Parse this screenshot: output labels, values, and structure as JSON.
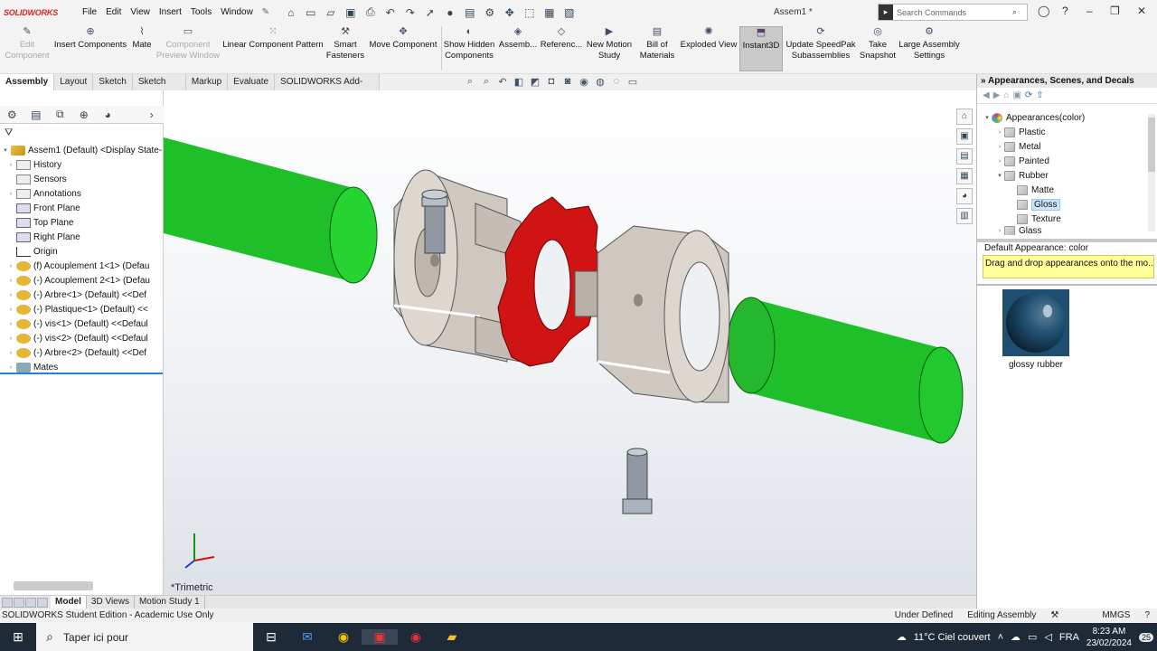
{
  "app": {
    "logo": "SOLIDWORKS",
    "document_title": "Assem1 *"
  },
  "menu": [
    "File",
    "Edit",
    "View",
    "Insert",
    "Tools",
    "Window"
  ],
  "search": {
    "placeholder": "Search Commands"
  },
  "commands": [
    {
      "label": "Edit Component",
      "state": "disabled"
    },
    {
      "label": "Insert Components",
      "state": "normal"
    },
    {
      "label": "Mate",
      "state": "normal"
    },
    {
      "label": "Component Preview Window",
      "state": "disabled"
    },
    {
      "label": "Linear Component Pattern",
      "state": "normal"
    },
    {
      "label": "Smart Fasteners",
      "state": "normal"
    },
    {
      "label": "Move Component",
      "state": "normal"
    },
    {
      "label": "Show Hidden Components",
      "state": "normal"
    },
    {
      "label": "Assemb...",
      "state": "normal"
    },
    {
      "label": "Referenc...",
      "state": "normal"
    },
    {
      "label": "New Motion Study",
      "state": "normal"
    },
    {
      "label": "Bill of Materials",
      "state": "normal"
    },
    {
      "label": "Exploded View",
      "state": "normal"
    },
    {
      "label": "Instant3D",
      "state": "active"
    },
    {
      "label": "Update SpeedPak Subassemblies",
      "state": "normal"
    },
    {
      "label": "Take Snapshot",
      "state": "normal"
    },
    {
      "label": "Large Assembly Settings",
      "state": "normal"
    }
  ],
  "tabs": [
    "Assembly",
    "Layout",
    "Sketch",
    "Sketch Ink",
    "Markup",
    "Evaluate",
    "SOLIDWORKS Add-Ins"
  ],
  "active_tab": "Assembly",
  "tree": [
    {
      "label": "Assem1 (Default) <Display State-",
      "icon": "assembly",
      "level": 0
    },
    {
      "label": "History",
      "icon": "history",
      "level": 1
    },
    {
      "label": "Sensors",
      "icon": "sensor",
      "level": 1
    },
    {
      "label": "Annotations",
      "icon": "annotation",
      "level": 1
    },
    {
      "label": "Front Plane",
      "icon": "plane",
      "level": 1
    },
    {
      "label": "Top Plane",
      "icon": "plane",
      "level": 1
    },
    {
      "label": "Right Plane",
      "icon": "plane",
      "level": 1
    },
    {
      "label": "Origin",
      "icon": "origin",
      "level": 1
    },
    {
      "label": "(f) Acouplement 1<1> (Defau",
      "icon": "part",
      "level": 1
    },
    {
      "label": "(-) Acouplement 2<1> (Defau",
      "icon": "part",
      "level": 1
    },
    {
      "label": "(-) Arbre<1> (Default) <<Def",
      "icon": "part",
      "level": 1
    },
    {
      "label": "(-) Plastique<1> (Default) <<",
      "icon": "part",
      "level": 1
    },
    {
      "label": "(-) vis<1> (Default) <<Defaul",
      "icon": "part",
      "level": 1
    },
    {
      "label": "(-) vis<2> (Default) <<Defaul",
      "icon": "part",
      "level": 1
    },
    {
      "label": "(-) Arbre<2> (Default) <<Def",
      "icon": "part",
      "level": 1
    },
    {
      "label": "Mates",
      "icon": "mates",
      "level": 1
    }
  ],
  "viewport": {
    "view_label": "*Trimetric"
  },
  "bottom_tabs": [
    "Model",
    "3D Views",
    "Motion Study 1"
  ],
  "status": {
    "left": "SOLIDWORKS Student Edition - Academic Use Only",
    "state": "Under Defined",
    "mode": "Editing Assembly",
    "units": "MMGS"
  },
  "taskpane": {
    "title": "Appearances, Scenes, and Decals",
    "items": [
      {
        "label": "Appearances(color)",
        "level": 0,
        "expanded": true
      },
      {
        "label": "Plastic",
        "level": 1,
        "expanded": false
      },
      {
        "label": "Metal",
        "level": 1,
        "expanded": false
      },
      {
        "label": "Painted",
        "level": 1,
        "expanded": false
      },
      {
        "label": "Rubber",
        "level": 1,
        "expanded": true
      },
      {
        "label": "Matte",
        "level": 2
      },
      {
        "label": "Gloss",
        "level": 2,
        "selected": true
      },
      {
        "label": "Texture",
        "level": 2
      },
      {
        "label": "Glass",
        "level": 1,
        "expanded": false
      }
    ],
    "default_appearance": "Default Appearance: color",
    "hint": "Drag and drop appearances onto the mo...",
    "swatch_label": "glossy rubber",
    "swatch_color": "#1f4f70"
  },
  "taskbar": {
    "search_placeholder": "Taper ici pour",
    "weather": "11°C  Ciel couvert",
    "lang": "FRA",
    "time": "8:23 AM",
    "date": "23/02/2024",
    "notif_count": "25"
  },
  "colors": {
    "shaft": "#1fbf2a",
    "spider": "#d01414",
    "coupling": "#d9d3cd",
    "bolt": "#9aa3ad"
  }
}
